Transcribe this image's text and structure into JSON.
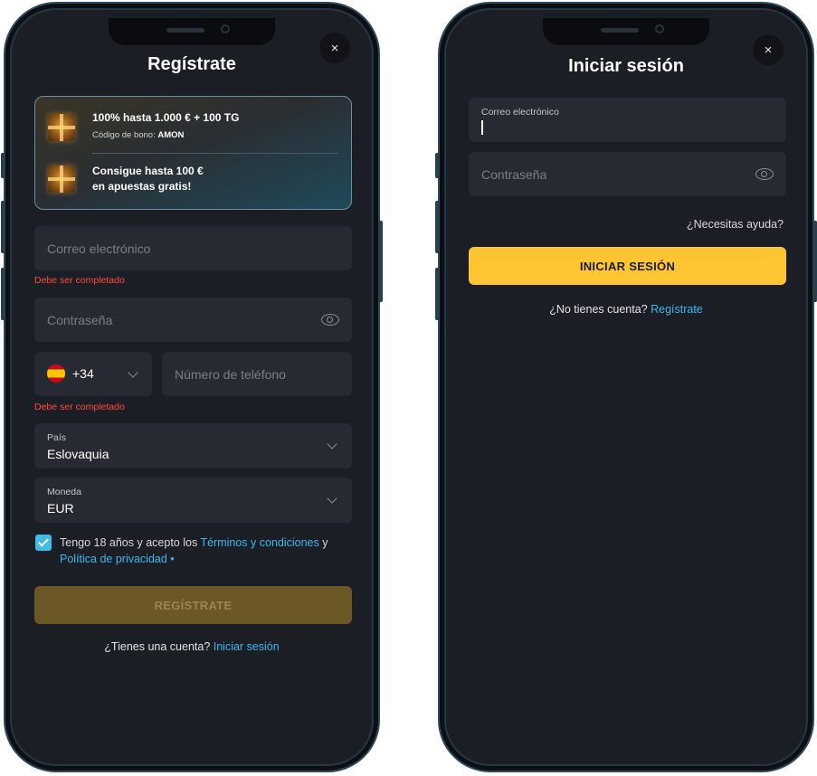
{
  "register": {
    "title": "Regístrate",
    "close_icon": "×",
    "promo": {
      "offer1_title": "100% hasta 1.000 € + 100 TG",
      "bonus_code_label": "Código de bono:",
      "bonus_code": "AMON",
      "offer2_line1": "Consigue hasta 100 €",
      "offer2_line2": "en apuestas gratis!"
    },
    "email_placeholder": "Correo electrónico",
    "email_error": "Debe ser completado",
    "password_placeholder": "Contraseña",
    "phone_code": "+34",
    "phone_placeholder": "Número de teléfono",
    "phone_error": "Debe ser completado",
    "country_label": "País",
    "country_value": "Eslovaquia",
    "currency_label": "Moneda",
    "currency_value": "EUR",
    "terms_text_1": "Tengo 18 años y acepto los ",
    "terms_link": "Términos y condiciones",
    "terms_text_2": " y",
    "privacy_link": "Política de privacidad",
    "privacy_suffix": " •",
    "submit_label": "REGÍSTRATE",
    "have_account_text": "¿Tienes una cuenta? ",
    "login_link": "Iniciar sesión"
  },
  "login": {
    "title": "Iniciar sesión",
    "close_icon": "×",
    "email_label": "Correo electrónico",
    "password_placeholder": "Contraseña",
    "help_link": "¿Necesitas ayuda?",
    "submit_label": "INICIAR SESIÓN",
    "no_account_text": "¿No tienes cuenta? ",
    "register_link": "Regístrate"
  },
  "colors": {
    "accent": "#ffc533",
    "link": "#39b8f0",
    "error": "#ff4a3d",
    "background": "#1c1e25",
    "field": "#272a33"
  },
  "icons": [
    "close-icon",
    "gift-icon",
    "eye-icon",
    "chevron-down-icon",
    "spain-flag-icon",
    "check-icon"
  ]
}
